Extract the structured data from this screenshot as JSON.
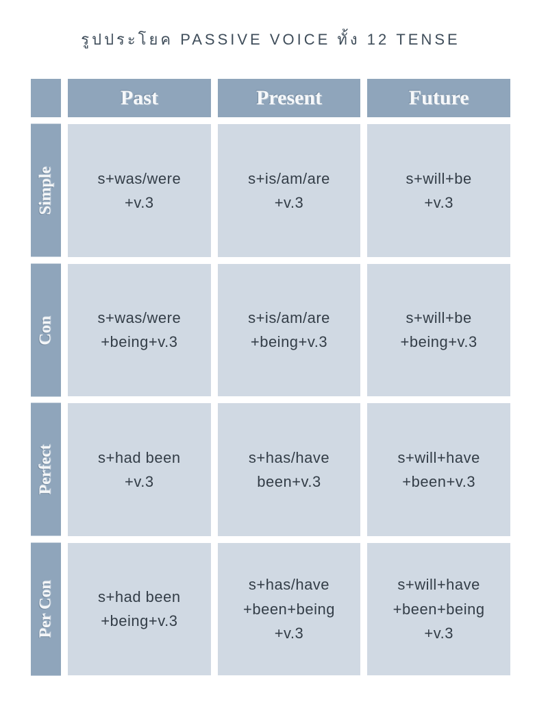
{
  "title": "รูปประโยค PASSIVE VOICE ทั้ง 12 TENSE",
  "cols": {
    "c0": "Past",
    "c1": "Present",
    "c2": "Future"
  },
  "rows": {
    "r0": "Simple",
    "r1": "Con",
    "r2": "Perfect",
    "r3": "Per Con"
  },
  "cells": {
    "r0c0": "s+was/were\n+v.3",
    "r0c1": "s+is/am/are\n+v.3",
    "r0c2": "s+will+be\n+v.3",
    "r1c0": "s+was/were\n+being+v.3",
    "r1c1": "s+is/am/are\n+being+v.3",
    "r1c2": "s+will+be\n+being+v.3",
    "r2c0": "s+had  been\n+v.3",
    "r2c1": "s+has/have\nbeen+v.3",
    "r2c2": "s+will+have\n+been+v.3",
    "r3c0": "s+had  been\n+being+v.3",
    "r3c1": "s+has/have\n+been+being\n+v.3",
    "r3c2": "s+will+have\n+been+being\n+v.3"
  },
  "chart_data": {
    "type": "table",
    "title": "รูปประโยค PASSIVE VOICE ทั้ง 12 TENSE",
    "columns": [
      "Past",
      "Present",
      "Future"
    ],
    "rows": [
      "Simple",
      "Con",
      "Perfect",
      "Per Con"
    ],
    "values": [
      [
        "s+was/were+v.3",
        "s+is/am/are+v.3",
        "s+will+be+v.3"
      ],
      [
        "s+was/were+being+v.3",
        "s+is/am/are+being+v.3",
        "s+will+be+being+v.3"
      ],
      [
        "s+had been+v.3",
        "s+has/have been+v.3",
        "s+will+have+been+v.3"
      ],
      [
        "s+had been+being+v.3",
        "s+has/have+been+being+v.3",
        "s+will+have+been+being+v.3"
      ]
    ]
  }
}
